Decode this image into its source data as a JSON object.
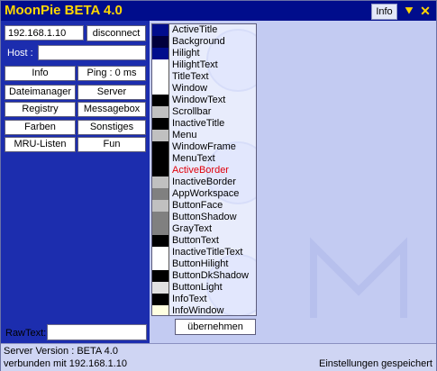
{
  "window": {
    "title": "MoonPie BETA 4.0",
    "info_tab": "Info",
    "minimize_glyph": "⯆",
    "close_glyph": "✕"
  },
  "connection": {
    "ip_value": "192.168.1.10",
    "disconnect_label": "disconnect",
    "host_label": "Host :",
    "host_value": ""
  },
  "nav_buttons": {
    "info": "Info",
    "ping": "Ping : 0 ms",
    "dateimanager": "Dateimanager",
    "server": "Server",
    "registry": "Registry",
    "messagebox": "Messagebox",
    "farben": "Farben",
    "sonstiges": "Sonstiges",
    "mru": "MRU-Listen",
    "fun": "Fun"
  },
  "rawtext": {
    "label": "RawText:",
    "value": ""
  },
  "colors": [
    {
      "name": "ActiveTitle",
      "swatch": "#000d8c"
    },
    {
      "name": "Background",
      "swatch": "#00003c"
    },
    {
      "name": "Hilight",
      "swatch": "#000d8c"
    },
    {
      "name": "HilightText",
      "swatch": "#ffffff"
    },
    {
      "name": "TitleText",
      "swatch": "#ffffff"
    },
    {
      "name": "Window",
      "swatch": "#ffffff"
    },
    {
      "name": "WindowText",
      "swatch": "#000000"
    },
    {
      "name": "Scrollbar",
      "swatch": "#c0c0c0"
    },
    {
      "name": "InactiveTitle",
      "swatch": "#000000"
    },
    {
      "name": "Menu",
      "swatch": "#c0c0c0"
    },
    {
      "name": "WindowFrame",
      "swatch": "#000000"
    },
    {
      "name": "MenuText",
      "swatch": "#000000"
    },
    {
      "name": "ActiveBorder",
      "swatch": "#000000",
      "highlight": true
    },
    {
      "name": "InactiveBorder",
      "swatch": "#c0c0c0"
    },
    {
      "name": "AppWorkspace",
      "swatch": "#808080"
    },
    {
      "name": "ButtonFace",
      "swatch": "#c0c0c0"
    },
    {
      "name": "ButtonShadow",
      "swatch": "#808080"
    },
    {
      "name": "GrayText",
      "swatch": "#808080"
    },
    {
      "name": "ButtonText",
      "swatch": "#000000"
    },
    {
      "name": "InactiveTitleText",
      "swatch": "#ffffff"
    },
    {
      "name": "ButtonHilight",
      "swatch": "#ffffff"
    },
    {
      "name": "ButtonDkShadow",
      "swatch": "#000000"
    },
    {
      "name": "ButtonLight",
      "swatch": "#e0e0e0"
    },
    {
      "name": "InfoText",
      "swatch": "#000000"
    },
    {
      "name": "InfoWindow",
      "swatch": "#ffffe1"
    }
  ],
  "apply_label": "übernehmen",
  "status": {
    "server_version": "Server Version : BETA 4.0",
    "connected": "verbunden mit 192.168.1.10",
    "saved": "Einstellungen gespeichert"
  },
  "palette": {
    "titlebar_bg": "#000d8c",
    "title_fg": "#ffd700",
    "left_panel_bg": "#1c2dae",
    "window_bg": "#c3cbf2",
    "highlight_text": "#e0000a"
  }
}
